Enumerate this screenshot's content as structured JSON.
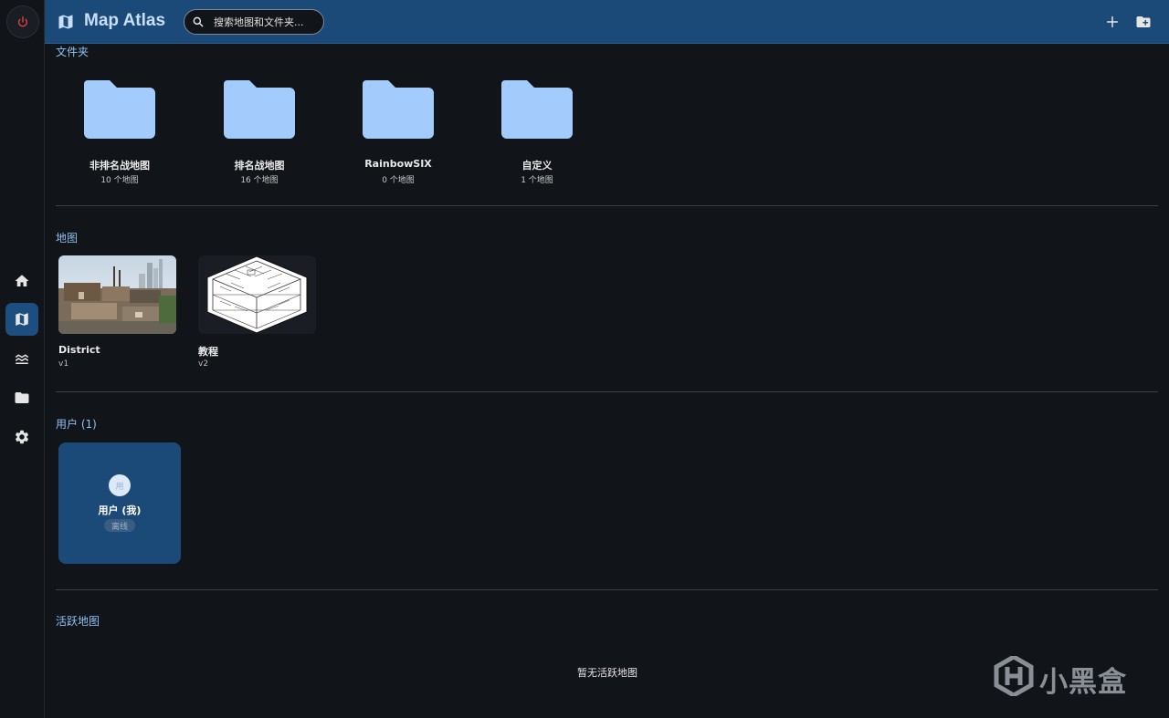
{
  "app": {
    "title": "Map Atlas"
  },
  "search": {
    "placeholder": "搜索地图和文件夹..."
  },
  "header_actions": {
    "add_icon": "plus-icon",
    "new_folder_icon": "folder-plus-icon"
  },
  "sidebar": {
    "items": [
      {
        "name": "home",
        "icon": "home-icon",
        "active": false
      },
      {
        "name": "maps",
        "icon": "map-icon",
        "active": true
      },
      {
        "name": "layers",
        "icon": "layers-icon",
        "active": false
      },
      {
        "name": "folders",
        "icon": "folder-icon",
        "active": false
      },
      {
        "name": "settings",
        "icon": "gear-icon",
        "active": false
      }
    ],
    "power_icon": "power-icon"
  },
  "folders": {
    "title": "文件夹",
    "items": [
      {
        "name": "非排名战地图",
        "count": "10 个地图"
      },
      {
        "name": "排名战地图",
        "count": "16 个地图"
      },
      {
        "name": "RainbowSIX",
        "count": "0 个地图"
      },
      {
        "name": "自定义",
        "count": "1 个地图"
      }
    ]
  },
  "maps": {
    "title": "地图",
    "items": [
      {
        "name": "District",
        "version": "v1"
      },
      {
        "name": "教程",
        "version": "v2"
      }
    ]
  },
  "users": {
    "title": "用户 (1)",
    "items": [
      {
        "avatar": "用",
        "name": "用户 (我)",
        "status": "离线"
      }
    ]
  },
  "active_maps": {
    "title": "活跃地图",
    "empty": "暂无活跃地图"
  },
  "watermark": {
    "text": "小黑盒"
  },
  "colors": {
    "background": "#111419",
    "header": "#1c4a78",
    "accent": "#8fc0f2",
    "folder": "#a3cbfb",
    "power": "#e04040"
  }
}
